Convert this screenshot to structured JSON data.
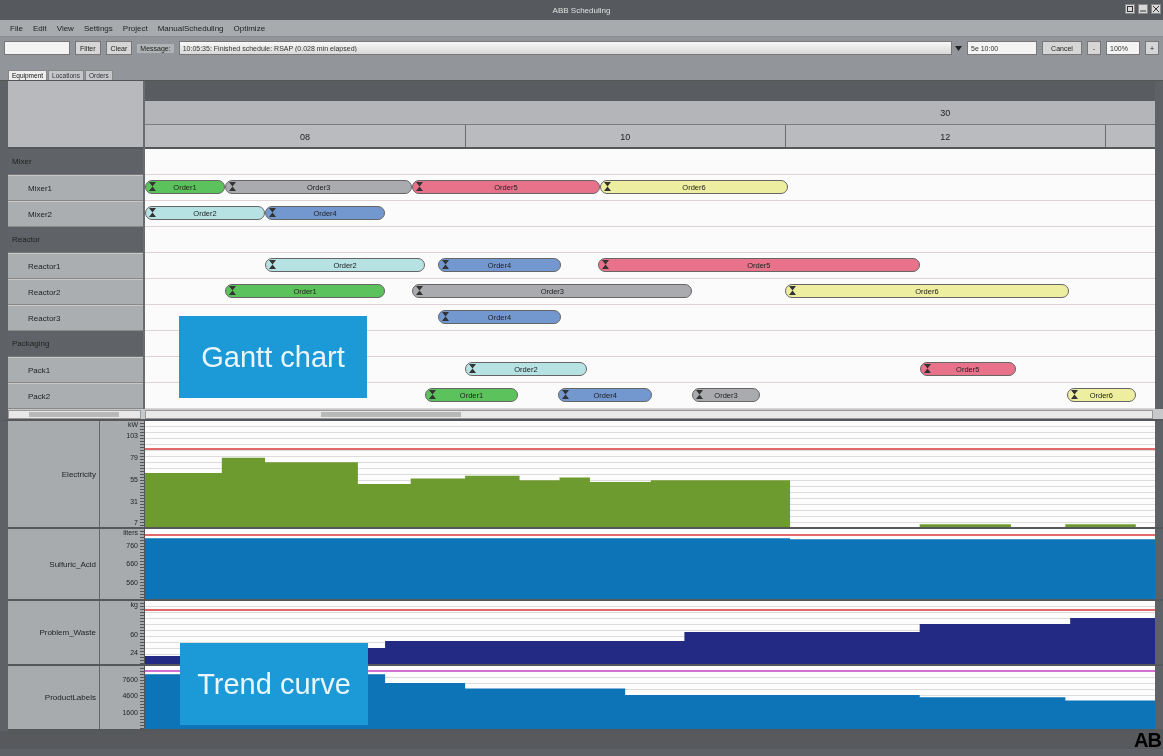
{
  "window": {
    "title": "ABB Scheduling"
  },
  "menu": [
    "File",
    "Edit",
    "View",
    "Settings",
    "Project",
    "ManualScheduling",
    "Optimize"
  ],
  "toolbar": {
    "filter_button": "Filter",
    "clear_button": "Clear",
    "message_label": "Message:",
    "message": "10:05:35: Finished schedule: RSAP (0.028 min elapsed)",
    "time_field": "5e 10:00",
    "cancel_button": "Cancel",
    "zoom_out": "-",
    "zoom": "100%",
    "zoom_in": "+"
  },
  "tabs": [
    {
      "label": "Equipment",
      "selected": true
    },
    {
      "label": "Locations",
      "selected": false
    },
    {
      "label": "Orders",
      "selected": false
    }
  ],
  "gantt": {
    "day": "30",
    "ticks": [
      "08",
      "10",
      "12"
    ],
    "groups": [
      {
        "label": "Mixer",
        "children": [
          {
            "label": "Mixer1",
            "bars": [
              {
                "label": "Order1",
                "color": "#5cc35c"
              },
              {
                "label": "Order3",
                "color": "#a9abae"
              },
              {
                "label": "Order5",
                "color": "#e8728a"
              },
              {
                "label": "Order6",
                "color": "#eeeea0"
              }
            ]
          },
          {
            "label": "Mixer2",
            "bars": [
              {
                "label": "Order2",
                "color": "#b6e2e4"
              },
              {
                "label": "Order4",
                "color": "#7397cf"
              }
            ]
          }
        ]
      },
      {
        "label": "Reactor",
        "children": [
          {
            "label": "Reactor1",
            "bars": [
              {
                "label": "Order2",
                "color": "#b6e2e4"
              },
              {
                "label": "Order4",
                "color": "#7397cf"
              },
              {
                "label": "Order5",
                "color": "#e8728a"
              }
            ]
          },
          {
            "label": "Reactor2",
            "bars": [
              {
                "label": "Order1",
                "color": "#5cc35c"
              },
              {
                "label": "Order3",
                "color": "#a9abae"
              },
              {
                "label": "Order6",
                "color": "#eeeea0"
              }
            ]
          },
          {
            "label": "Reactor3",
            "bars": [
              {
                "label": "Order4",
                "color": "#7397cf"
              }
            ]
          }
        ]
      },
      {
        "label": "Packaging",
        "children": [
          {
            "label": "Pack1",
            "bars": [
              {
                "label": "Order2",
                "color": "#b6e2e4"
              },
              {
                "label": "Order5",
                "color": "#e8728a"
              }
            ]
          },
          {
            "label": "Pack2",
            "bars": [
              {
                "label": "Order1",
                "color": "#5cc35c"
              },
              {
                "label": "Order4",
                "color": "#7397cf"
              },
              {
                "label": "Order3",
                "color": "#a9abae"
              },
              {
                "label": "Order6",
                "color": "#eeeea0"
              }
            ]
          }
        ]
      }
    ],
    "callout": {
      "text": "Gantt chart"
    }
  },
  "trends": {
    "rows": [
      {
        "label": "Electricity",
        "unit": "kW",
        "ticks": [
          "103",
          "79",
          "55",
          "31",
          "7"
        ],
        "color": "#6e9b2f"
      },
      {
        "label": "Sulfuric_Acid",
        "unit": "liters",
        "ticks": [
          "760",
          "660",
          "560"
        ],
        "color": "#0d74b8"
      },
      {
        "label": "Problem_Waste",
        "unit": "kg",
        "ticks": [
          "60",
          "24"
        ],
        "color": "#232a84"
      },
      {
        "label": "ProductLabels",
        "ticks": [
          "7600",
          "4600",
          "1600"
        ],
        "color": "#0d74b8"
      }
    ],
    "callout": {
      "text": "Trend curve"
    }
  },
  "logo": "AB"
}
